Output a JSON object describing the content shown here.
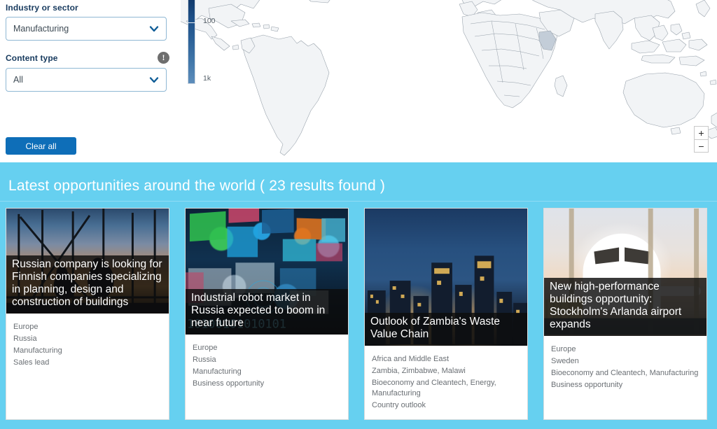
{
  "filters": {
    "industry": {
      "label": "Industry or sector",
      "value": "Manufacturing",
      "icon": "chevron-down-icon"
    },
    "content_type": {
      "label": "Content type",
      "value": "All",
      "info_icon": "info-exclamation-icon",
      "info_glyph": "!",
      "icon": "chevron-down-icon"
    },
    "clear_all_label": "Clear all"
  },
  "map": {
    "legend": {
      "top_label": "100",
      "bottom_label": "1k",
      "gradient_top_color": "#123a6b",
      "gradient_bottom_color": "#5d8dbb"
    },
    "zoom_in_label": "+",
    "zoom_out_label": "−",
    "land_color": "#f2f4f6",
    "border_color": "#8e9aa5"
  },
  "results": {
    "heading": "Latest opportunities around the world ( 23 results found )",
    "banner_color": "#66d0f0",
    "cards": [
      {
        "title": "Russian company is looking for Finnish companies specializing in planning, design and construction of buildings",
        "image": "construction-workers-sunset-photo",
        "region": "Europe",
        "country": "Russia",
        "sector": "Manufacturing",
        "type": "Sales lead"
      },
      {
        "title": "Industrial robot market in Russia expected to boom in near future",
        "image": "digital-screens-technology-photo",
        "region": "Europe",
        "country": "Russia",
        "sector": "Manufacturing",
        "type": "Business opportunity"
      },
      {
        "title": "Outlook of Zambia's Waste Value Chain",
        "image": "city-skyline-dusk-photo",
        "region": "Africa and Middle East",
        "country": "Zambia, Zimbabwe, Malawi",
        "sector": "Bioeconomy and Cleantech, Energy, Manufacturing",
        "type": "Country outlook"
      },
      {
        "title": "New high-performance buildings opportunity: Stockholm's Arlanda airport expands",
        "image": "airplane-terminal-window-photo",
        "region": "Europe",
        "country": "Sweden",
        "sector": "Bioeconomy and Cleantech, Manufacturing",
        "type": "Business opportunity"
      }
    ]
  }
}
